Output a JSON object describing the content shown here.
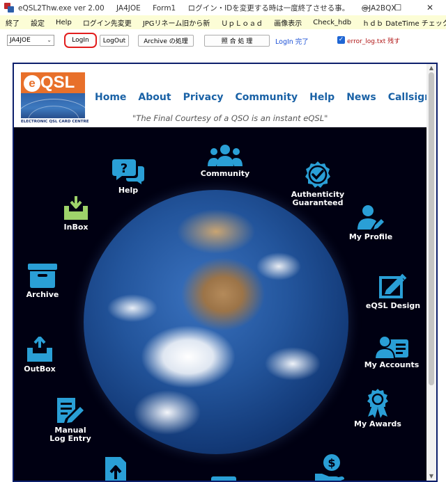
{
  "titlebar": {
    "items": [
      "eQSL2Thw.exe ver 2.00",
      "JA4JOE",
      "Form1",
      "ログイン・IDを変更する時は一度終了させる事。",
      "@JA2BQX"
    ],
    "minimize": "—",
    "maximize": "☐",
    "close": "✕"
  },
  "menu": {
    "items": [
      "終了",
      "設定",
      "Help",
      "ログイン先変更",
      "JPGリネーム旧から新",
      "ＵｐＬｏａｄ",
      "画像表示",
      "Check_hdb",
      "ｈｄｂ DateTime チェック"
    ]
  },
  "toolbar": {
    "callsign": "JA4JOE",
    "login": "LogIn",
    "logout": "LogOut",
    "archive": "Archive の処理",
    "shogo": "照 合 処 理",
    "status": "LogIn 完了",
    "error_log_checked": true,
    "error_log_label": "error_log.txt 残す"
  },
  "site": {
    "logo_e": "e",
    "logo_qsl": "QSL",
    "logo_caption": "ELECTRONIC QSL CARD CENTRE",
    "nav": [
      "Home",
      "About",
      "Privacy",
      "Community",
      "Help",
      "News",
      "Callsign Search"
    ],
    "tagline": "\"The Final Courtesy of a QSO is an instant eQSL\"",
    "icons": {
      "community": "Community",
      "help": "Help",
      "authenticity": "Authenticity\nGuaranteed",
      "inbox": "InBox",
      "my_profile": "My Profile",
      "archive": "Archive",
      "eqsl_design": "eQSL Design",
      "outbox": "OutBox",
      "my_accounts": "My Accounts",
      "manual_log": "Manual\nLog Entry",
      "my_awards": "My Awards"
    },
    "icon_color": "#2a9fd6",
    "nav_color": "#1a62a6"
  }
}
